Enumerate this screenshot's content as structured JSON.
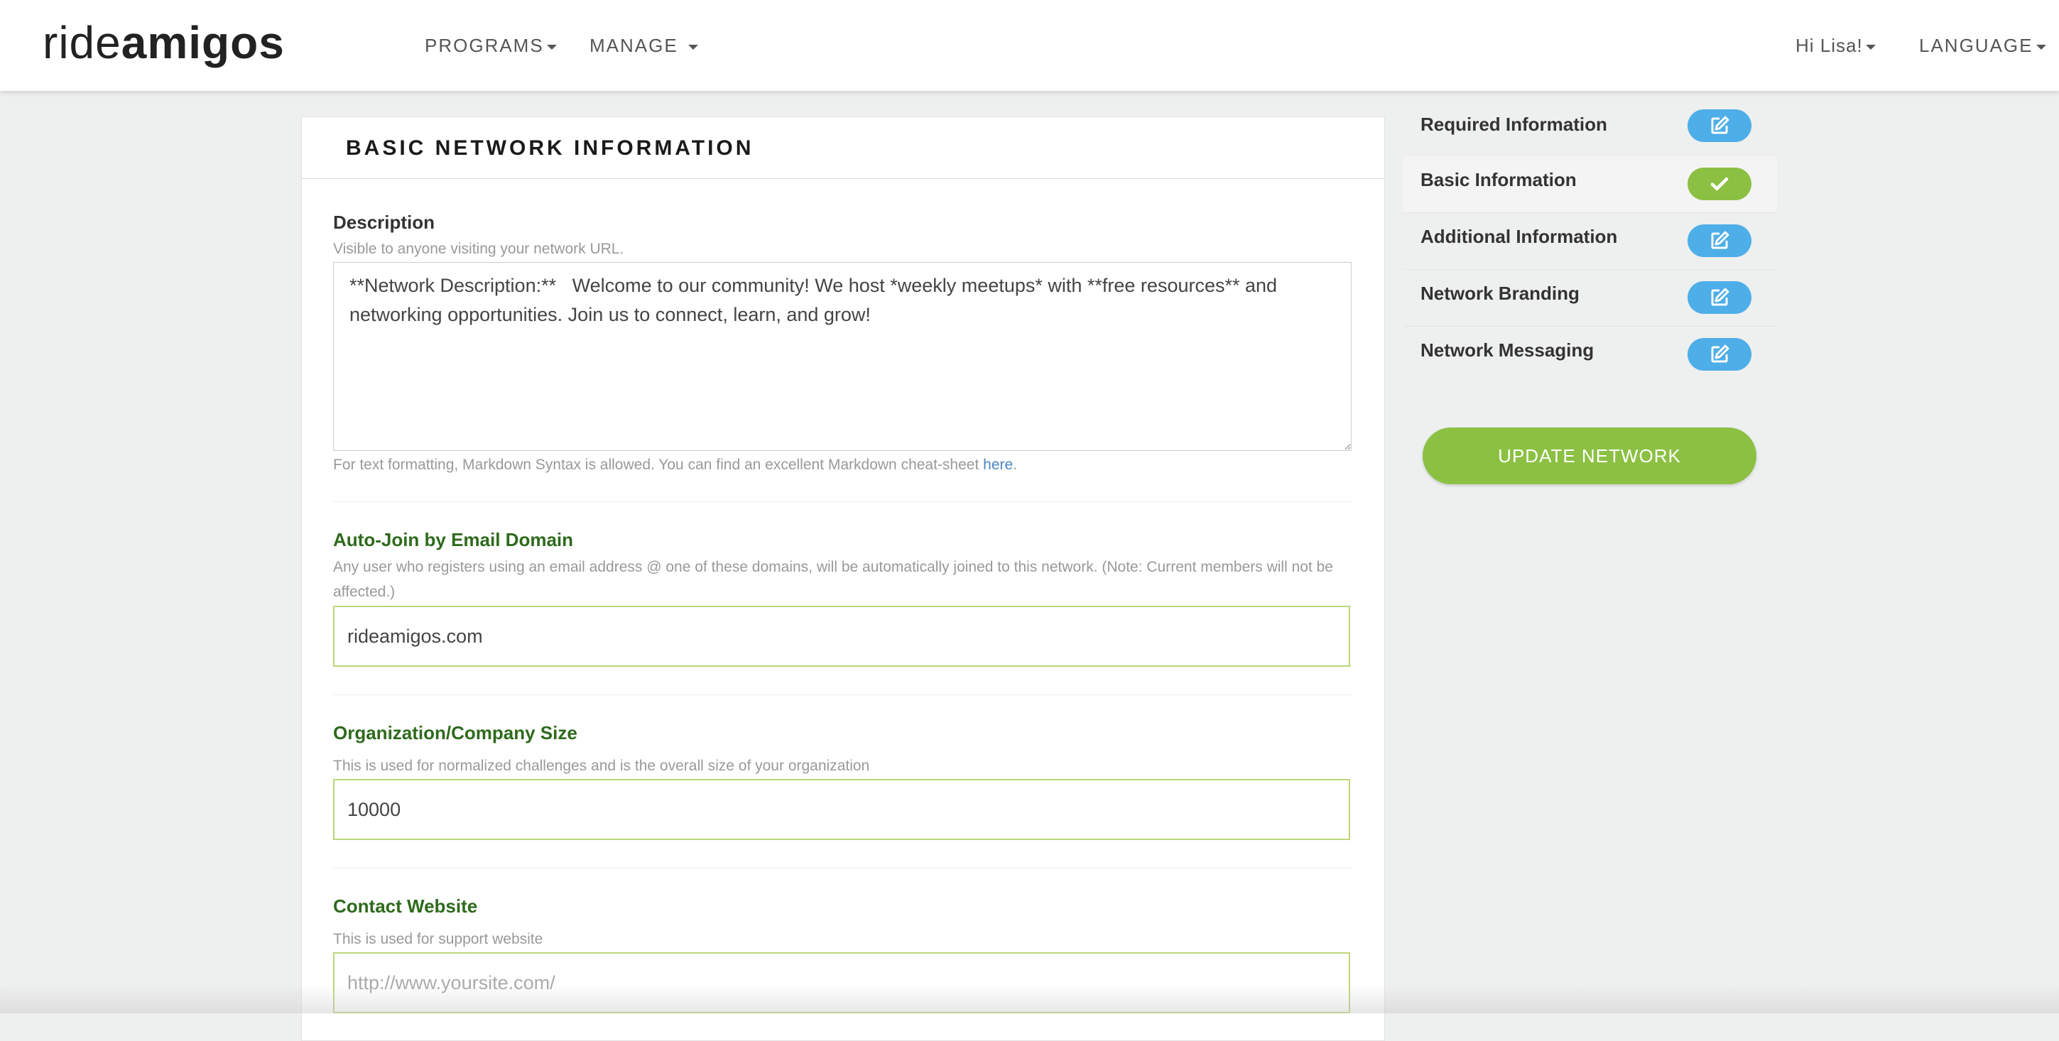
{
  "header": {
    "logo_light": "ride",
    "logo_bold": "amigos",
    "nav": {
      "programs": "PROGRAMS",
      "manage": "MANAGE",
      "user": "Hi Lisa!",
      "language": "LANGUAGE"
    }
  },
  "card": {
    "title": "BASIC NETWORK INFORMATION",
    "description": {
      "label": "Description",
      "help": "Visible to anyone visiting your network URL.",
      "value": "**Network Description:**   Welcome to our community! We host *weekly meetups* with **free resources** and networking opportunities. Join us to connect, learn, and grow!",
      "footnote": "For text formatting, Markdown Syntax is allowed. You can find an excellent Markdown cheat-sheet",
      "link": "here",
      "link_suffix": "."
    },
    "auto_join": {
      "label": "Auto-Join by Email Domain",
      "help": "Any user who registers using an email address @ one of these domains, will be automatically joined to this network. (Note: Current members will not be affected.)",
      "value": "rideamigos.com"
    },
    "org_size": {
      "label": "Organization/Company Size",
      "help": "This is used for normalized challenges and is the overall size of your organization",
      "value": "10000"
    },
    "contact_website": {
      "label": "Contact Website",
      "help": "This is used for support website",
      "value": "",
      "placeholder": "http://www.yoursite.com/"
    }
  },
  "sidebar": {
    "items": [
      {
        "label": "Required Information",
        "status": "edit",
        "icon": "edit-icon"
      },
      {
        "label": "Basic Information",
        "status": "complete",
        "icon": "check-icon"
      },
      {
        "label": "Additional Information",
        "status": "edit",
        "icon": "edit-icon"
      },
      {
        "label": "Network Branding",
        "status": "edit",
        "icon": "edit-icon"
      },
      {
        "label": "Network Messaging",
        "status": "edit",
        "icon": "edit-icon"
      }
    ],
    "update_button": "UPDATE NETWORK"
  },
  "colors": {
    "accent_green": "#8cc043",
    "edit_blue": "#4eaee8",
    "label_green": "#2e6a1c",
    "input_border": "#bcd67a",
    "link_blue": "#4a86c5"
  }
}
